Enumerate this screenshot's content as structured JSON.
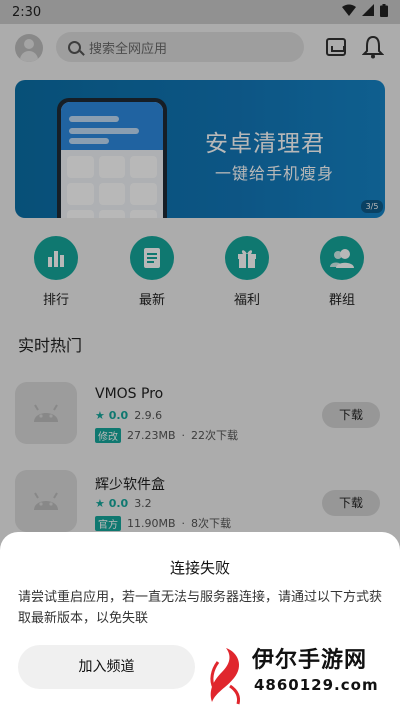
{
  "status": {
    "time": "2:30"
  },
  "search": {
    "placeholder": "搜索全网应用"
  },
  "banner": {
    "title": "安卓清理君",
    "subtitle": "一键给手机瘦身",
    "page": "3/5"
  },
  "nav": [
    {
      "label": "排行",
      "icon": "bar-chart-icon"
    },
    {
      "label": "最新",
      "icon": "document-icon"
    },
    {
      "label": "福利",
      "icon": "gift-icon"
    },
    {
      "label": "群组",
      "icon": "group-icon"
    }
  ],
  "section": {
    "title": "实时热门"
  },
  "apps": [
    {
      "name": "VMOS Pro",
      "rating": "★ 0.0",
      "version": "2.9.6",
      "tag": "修改",
      "size": "27.23MB",
      "downloads": "22次下载",
      "button": "下载"
    },
    {
      "name": "辉少软件盒",
      "rating": "★ 0.0",
      "version": "3.2",
      "tag": "官方",
      "size": "11.90MB",
      "downloads": "8次下载",
      "button": "下载"
    }
  ],
  "dialog": {
    "title": "连接失败",
    "text": "请尝试重启应用，若一直无法与服务器连接，请通过以下方式获取最新版本，以免失联",
    "join_button": "加入频道"
  },
  "watermark": {
    "text": "伊尔手游网",
    "number": "4860129.com"
  },
  "colors": {
    "accent": "#16a79b",
    "banner": "#1277b8"
  }
}
